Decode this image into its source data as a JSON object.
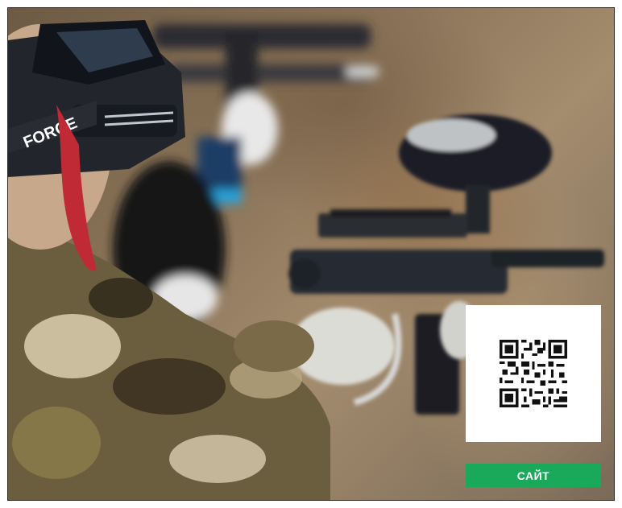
{
  "photo": {
    "mask_text": "FORCE"
  },
  "qr": {
    "icon": "qr-code-icon"
  },
  "site_button": {
    "label": "САЙТ",
    "color": "#1aa85a"
  }
}
